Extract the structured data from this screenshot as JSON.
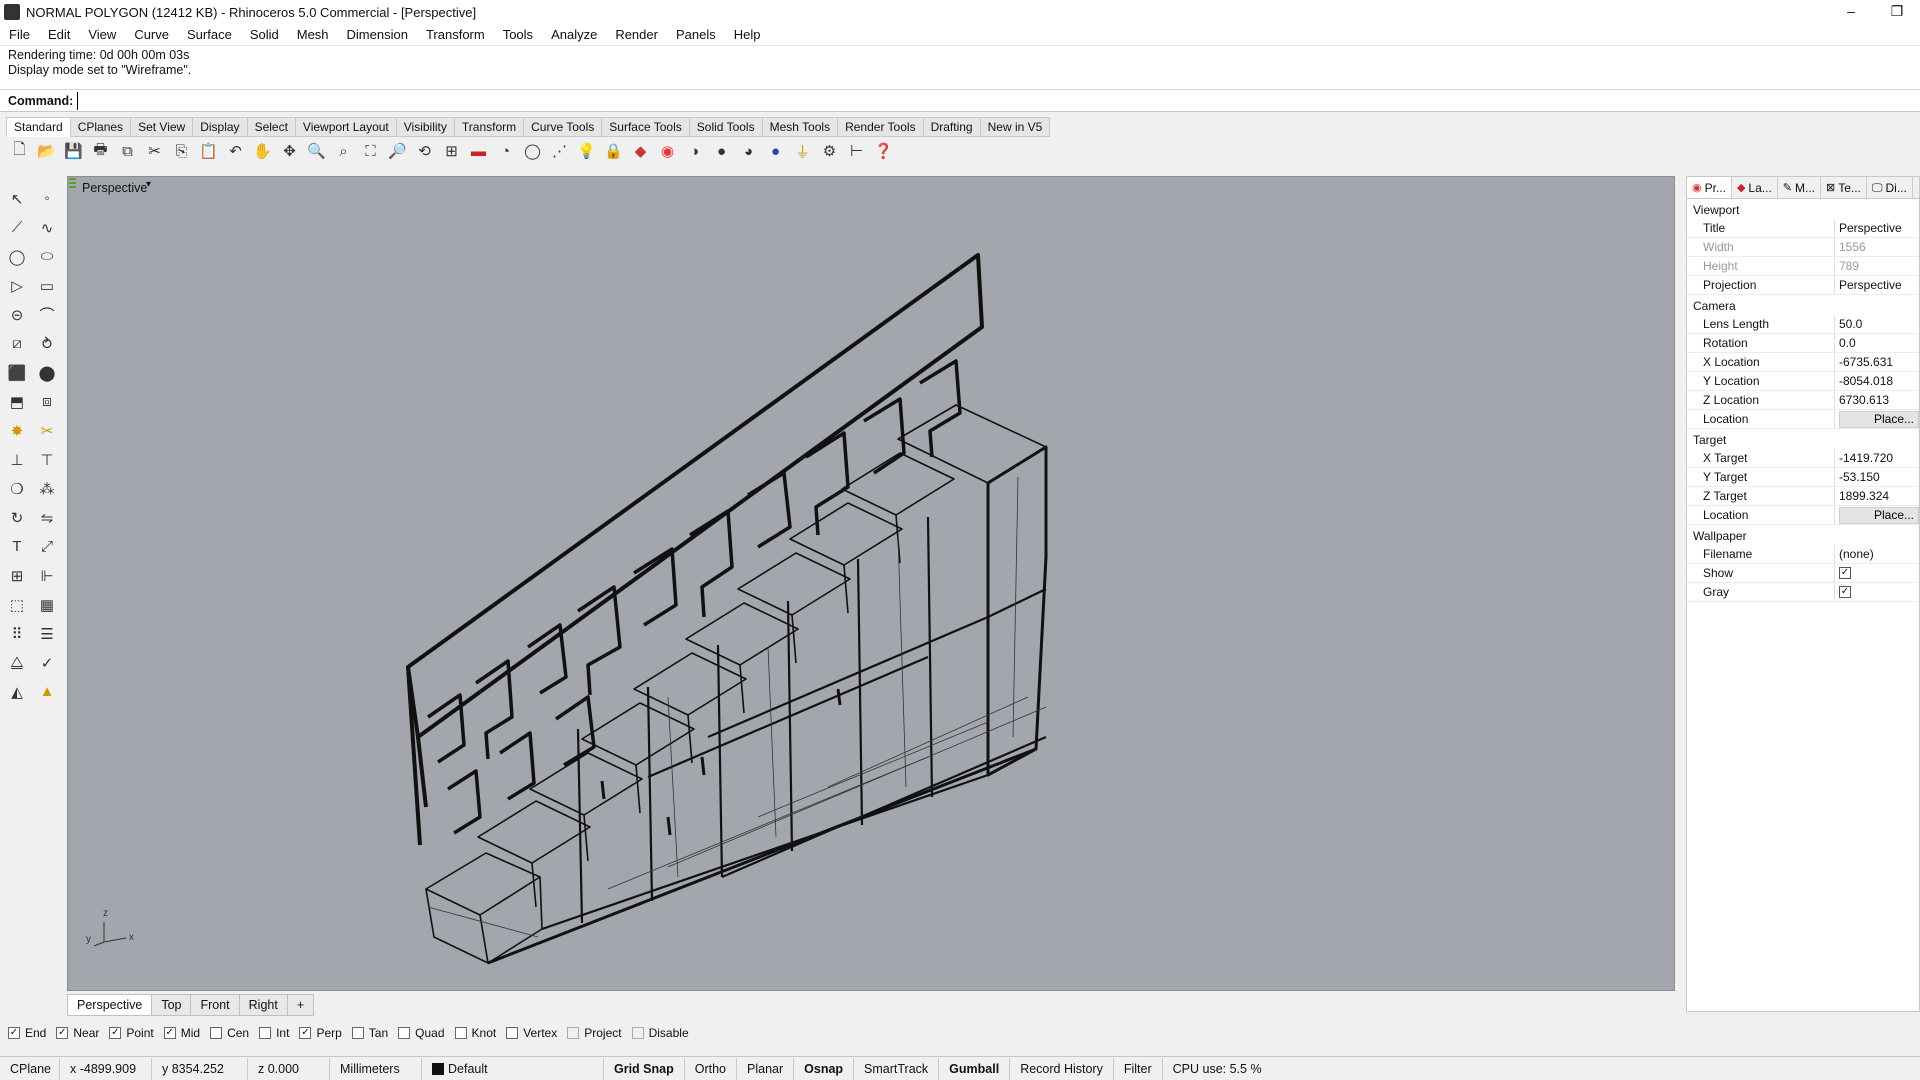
{
  "window": {
    "title": "NORMAL POLYGON (12412 KB) - Rhinoceros 5.0 Commercial - [Perspective]",
    "minimize_label": "–",
    "restore_label": "❐"
  },
  "menu": [
    "File",
    "Edit",
    "View",
    "Curve",
    "Surface",
    "Solid",
    "Mesh",
    "Dimension",
    "Transform",
    "Tools",
    "Analyze",
    "Render",
    "Panels",
    "Help"
  ],
  "command_history": [
    "Rendering time: 0d 00h 00m 03s",
    "Display mode set to \"Wireframe\"."
  ],
  "command": {
    "label": "Command:",
    "value": ""
  },
  "toolbar_tabs": [
    "Standard",
    "CPlanes",
    "Set View",
    "Display",
    "Select",
    "Viewport Layout",
    "Visibility",
    "Transform",
    "Curve Tools",
    "Surface Tools",
    "Solid Tools",
    "Mesh Tools",
    "Render Tools",
    "Drafting",
    "New in V5"
  ],
  "toolbar_icons": [
    "new-file-icon",
    "open-file-icon",
    "save-icon",
    "print-icon",
    "import-icon",
    "cut-icon",
    "copy-icon",
    "paste-icon",
    "undo-icon",
    "pan-icon",
    "move-view-icon",
    "zoom-icon",
    "zoom-window-icon",
    "zoom-extents-icon",
    "zoom-selected-icon",
    "rotate-view-icon",
    "four-viewports-icon",
    "car-icon",
    "render-preview-icon",
    "circle-icon",
    "grid-snap-icon",
    "light-icon",
    "lock-icon",
    "layer-icon",
    "color-wheel-icon",
    "shaded-sphere-icon",
    "rendered-sphere-icon",
    "material-sphere-icon",
    "env-sphere-icon",
    "filter-icon",
    "options-gear-icon",
    "dimension-icon",
    "help-icon"
  ],
  "viewport": {
    "title": "Perspective",
    "caret": "▾",
    "axis_x": "x",
    "axis_y": "y",
    "axis_z": "z"
  },
  "viewport_tabs": [
    "Perspective",
    "Top",
    "Front",
    "Right"
  ],
  "viewport_tab_add": "+",
  "osnaps": [
    {
      "label": "End",
      "checked": true
    },
    {
      "label": "Near",
      "checked": true
    },
    {
      "label": "Point",
      "checked": true
    },
    {
      "label": "Mid",
      "checked": true
    },
    {
      "label": "Cen",
      "checked": false
    },
    {
      "label": "Int",
      "checked": false
    },
    {
      "label": "Perp",
      "checked": true
    },
    {
      "label": "Tan",
      "checked": false
    },
    {
      "label": "Quad",
      "checked": false
    },
    {
      "label": "Knot",
      "checked": false
    },
    {
      "label": "Vertex",
      "checked": false
    },
    {
      "label": "Project",
      "checked": false,
      "disabled": true
    },
    {
      "label": "Disable",
      "checked": false,
      "disabled": true
    }
  ],
  "status": {
    "cplane": "CPlane",
    "x": "x -4899.909",
    "y": "y 8354.252",
    "z": "z 0.000",
    "units": "Millimeters",
    "layer": "Default",
    "grid_snap": "Grid Snap",
    "ortho": "Ortho",
    "planar": "Planar",
    "osnap": "Osnap",
    "smarttrack": "SmartTrack",
    "gumball": "Gumball",
    "record_history": "Record History",
    "filter": "Filter",
    "cpu": "CPU use: 5.5 %"
  },
  "panel": {
    "tabs": [
      {
        "icon": "properties-icon",
        "label": "Pr..."
      },
      {
        "icon": "layers-icon",
        "label": "La..."
      },
      {
        "icon": "materials-icon",
        "label": "M..."
      },
      {
        "icon": "textures-icon",
        "label": "Te..."
      },
      {
        "icon": "display-icon",
        "label": "Di..."
      }
    ],
    "sections": {
      "viewport": "Viewport",
      "camera": "Camera",
      "target": "Target",
      "wallpaper": "Wallpaper"
    },
    "viewport_rows": [
      {
        "label": "Title",
        "value": "Perspective"
      },
      {
        "label": "Width",
        "value": "1556",
        "grey": true
      },
      {
        "label": "Height",
        "value": "789",
        "grey": true
      },
      {
        "label": "Projection",
        "value": "Perspective"
      }
    ],
    "camera_rows": [
      {
        "label": "Lens Length",
        "value": "50.0"
      },
      {
        "label": "Rotation",
        "value": "0.0"
      },
      {
        "label": "X Location",
        "value": "-6735.631"
      },
      {
        "label": "Y Location",
        "value": "-8054.018"
      },
      {
        "label": "Z Location",
        "value": "6730.613"
      }
    ],
    "camera_location": {
      "label": "Location",
      "button": "Place..."
    },
    "target_rows": [
      {
        "label": "X Target",
        "value": "-1419.720"
      },
      {
        "label": "Y Target",
        "value": "-53.150"
      },
      {
        "label": "Z Target",
        "value": "1899.324"
      }
    ],
    "target_location": {
      "label": "Location",
      "button": "Place..."
    },
    "wallpaper_rows": [
      {
        "label": "Filename",
        "value": "(none)"
      }
    ],
    "wallpaper_show": {
      "label": "Show",
      "checked": true
    },
    "wallpaper_gray": {
      "label": "Gray",
      "checked": true
    }
  }
}
